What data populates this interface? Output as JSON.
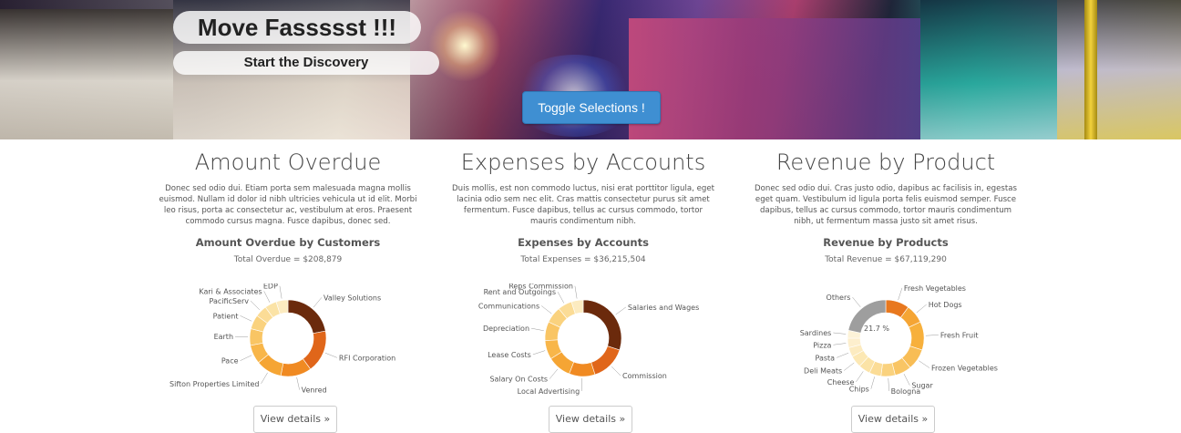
{
  "hero": {
    "title": "Move Fassssst !!!",
    "subtitle": "Start the Discovery",
    "toggle_label": "Toggle Selections !"
  },
  "columns": [
    {
      "heading": "Amount Overdue",
      "description": "Donec sed odio dui. Etiam porta sem malesuada magna mollis euismod. Nullam id dolor id nibh ultricies vehicula ut id elit. Morbi leo risus, porta ac consectetur ac, vestibulum at eros. Praesent commodo cursus magna. Fusce dapibus, donec sed.",
      "chart_title": "Amount Overdue by Customers",
      "total": "Total Overdue = $208,879",
      "button": "View details »"
    },
    {
      "heading": "Expenses by Accounts",
      "description": "Duis mollis, est non commodo luctus, nisi erat porttitor ligula, eget lacinia odio sem nec elit. Cras mattis consectetur purus sit amet fermentum. Fusce dapibus, tellus ac cursus commodo, tortor mauris condimentum nibh.",
      "chart_title": "Expenses by Accounts",
      "total": "Total Expenses = $36,215,504",
      "button": "View details »"
    },
    {
      "heading": "Revenue by Product",
      "description": "Donec sed odio dui. Cras justo odio, dapibus ac facilisis in, egestas eget quam. Vestibulum id ligula porta felis euismod semper. Fusce dapibus, tellus ac cursus commodo, tortor mauris condimentum nibh, ut fermentum massa justo sit amet risus.",
      "chart_title": "Revenue by Products",
      "total": "Total Revenue = $67,119,290",
      "button": "View details »"
    }
  ],
  "colors": {
    "toggle_button": "#3f8fd2",
    "dark_brown": "#6b2a0c",
    "orange": "#e8781e",
    "light_orange": "#f5b24a",
    "pale_yellow": "#fbe3a6",
    "grey": "#9e9e9e"
  },
  "chart_data": [
    {
      "type": "pie",
      "title": "Amount Overdue by Customers",
      "donut": true,
      "labels": [
        "Valley Solutions",
        "RFI Corporation",
        "Venred",
        "Sifton Properties Limited",
        "Pace",
        "Earth",
        "Patient",
        "PacificServ",
        "Kari & Associates",
        "EDP"
      ],
      "values": [
        22,
        18,
        13,
        11,
        8,
        7,
        6,
        5,
        5,
        5
      ],
      "colors": [
        "#6b2a0c",
        "#e0661a",
        "#f08a22",
        "#f5a534",
        "#f8b64a",
        "#f9c564",
        "#fad27e",
        "#fbdc96",
        "#fbe3a6",
        "#fcebc0"
      ]
    },
    {
      "type": "pie",
      "title": "Expenses by Accounts",
      "donut": true,
      "labels": [
        "Salaries and Wages",
        "Commission",
        "Local Advertising",
        "Salary On Costs",
        "Lease Costs",
        "Depreciation",
        "Communications",
        "Rent and Outgoings",
        "Reps Commission"
      ],
      "values": [
        30,
        15,
        11,
        10,
        8,
        8,
        7,
        6,
        5
      ],
      "colors": [
        "#6b2a0c",
        "#e0661a",
        "#f08a22",
        "#f5a534",
        "#f8b64a",
        "#f9c564",
        "#fad27e",
        "#fbdc96",
        "#fcebc0"
      ]
    },
    {
      "type": "pie",
      "title": "Revenue by Products",
      "donut": true,
      "labels": [
        "Fresh Vegetables",
        "Hot Dogs",
        "Fresh Fruit",
        "Frozen Vegetables",
        "Sugar",
        "Bologna",
        "Chips",
        "Cheese",
        "Deli Meats",
        "Pasta",
        "Pizza",
        "Sardines",
        "Others"
      ],
      "values": [
        10,
        8,
        12,
        9,
        7,
        6,
        5,
        5,
        5,
        4,
        4,
        3.3,
        21.7
      ],
      "colors": [
        "#e8781e",
        "#f5a534",
        "#f7b03c",
        "#f8bd55",
        "#f9c564",
        "#fad27e",
        "#fbdc96",
        "#fbe3a6",
        "#fce8b4",
        "#fcebc0",
        "#fdefcd",
        "#fdf3d8",
        "#9e9e9e"
      ],
      "annotation": "21.7 %"
    }
  ]
}
